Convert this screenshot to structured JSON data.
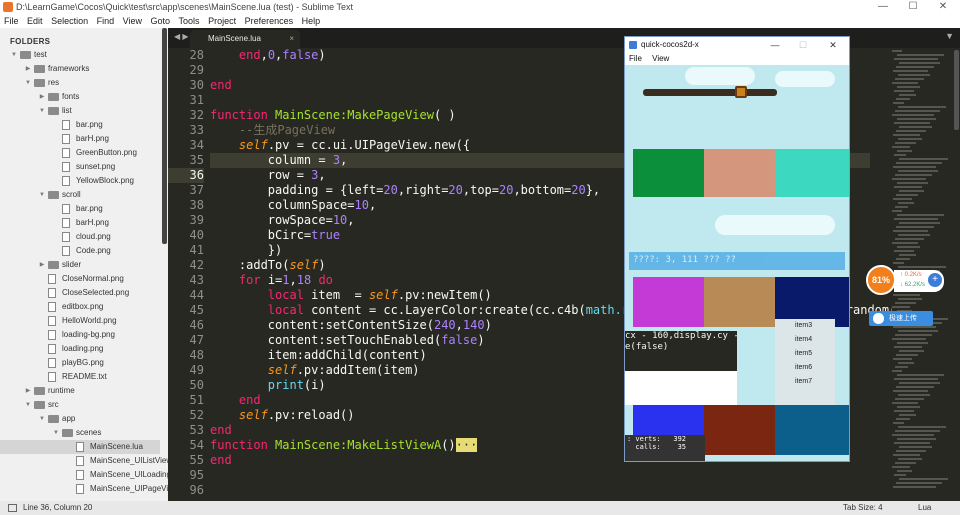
{
  "window": {
    "title": "D:\\LearnGame\\Cocos\\Quick\\test\\src\\app\\scenes\\MainScene.lua (test) - Sublime Text",
    "minimize": "—",
    "maximize": "☐",
    "close": "✕"
  },
  "menu": [
    "File",
    "Edit",
    "Selection",
    "Find",
    "View",
    "Goto",
    "Tools",
    "Project",
    "Preferences",
    "Help"
  ],
  "sidebar": {
    "header": "FOLDERS",
    "rows": [
      {
        "label": "test",
        "type": "folder",
        "depth": 0,
        "open": true
      },
      {
        "label": "frameworks",
        "type": "folder",
        "depth": 1,
        "open": false
      },
      {
        "label": "res",
        "type": "folder",
        "depth": 1,
        "open": true
      },
      {
        "label": "fonts",
        "type": "folder",
        "depth": 2,
        "open": false
      },
      {
        "label": "list",
        "type": "folder",
        "depth": 2,
        "open": true
      },
      {
        "label": "bar.png",
        "type": "file",
        "depth": 3
      },
      {
        "label": "barH.png",
        "type": "file",
        "depth": 3
      },
      {
        "label": "GreenButton.png",
        "type": "file",
        "depth": 3
      },
      {
        "label": "sunset.png",
        "type": "file",
        "depth": 3
      },
      {
        "label": "YellowBlock.png",
        "type": "file",
        "depth": 3
      },
      {
        "label": "scroll",
        "type": "folder",
        "depth": 2,
        "open": true
      },
      {
        "label": "bar.png",
        "type": "file",
        "depth": 3
      },
      {
        "label": "barH.png",
        "type": "file",
        "depth": 3
      },
      {
        "label": "cloud.png",
        "type": "file",
        "depth": 3
      },
      {
        "label": "Code.png",
        "type": "file",
        "depth": 3
      },
      {
        "label": "slider",
        "type": "folder",
        "depth": 2,
        "open": false
      },
      {
        "label": "CloseNormal.png",
        "type": "file",
        "depth": 2
      },
      {
        "label": "CloseSelected.png",
        "type": "file",
        "depth": 2
      },
      {
        "label": "editbox.png",
        "type": "file",
        "depth": 2
      },
      {
        "label": "HelloWorld.png",
        "type": "file",
        "depth": 2
      },
      {
        "label": "loading-bg.png",
        "type": "file",
        "depth": 2
      },
      {
        "label": "loading.png",
        "type": "file",
        "depth": 2
      },
      {
        "label": "playBG.png",
        "type": "file",
        "depth": 2
      },
      {
        "label": "README.txt",
        "type": "file",
        "depth": 2
      },
      {
        "label": "runtime",
        "type": "folder",
        "depth": 1,
        "open": false
      },
      {
        "label": "src",
        "type": "folder",
        "depth": 1,
        "open": true
      },
      {
        "label": "app",
        "type": "folder",
        "depth": 2,
        "open": true
      },
      {
        "label": "scenes",
        "type": "folder",
        "depth": 3,
        "open": true
      },
      {
        "label": "MainScene.lua",
        "type": "file",
        "depth": 4,
        "selected": true
      },
      {
        "label": "MainScene_UIListView.lua",
        "type": "file",
        "depth": 4
      },
      {
        "label": "MainScene_UILoadingBar.lua",
        "type": "file",
        "depth": 4
      },
      {
        "label": "MainScene_UIPageView.lua",
        "type": "file",
        "depth": 4
      }
    ]
  },
  "tab": {
    "label": "MainScene.lua",
    "close": "×"
  },
  "editor": {
    "line_numbers": [
      "28",
      "29",
      "30",
      "31",
      "32",
      "33",
      "34",
      "35",
      "36",
      "37",
      "38",
      "39",
      "40",
      "41",
      "42",
      "43",
      "44",
      "45",
      "46",
      "47",
      "48",
      "49",
      "50",
      "51",
      "52",
      "53",
      "54",
      "55",
      "95",
      "96"
    ],
    "current_line": "36"
  },
  "simulator": {
    "title": "quick-cocos2d-x",
    "menu": [
      "File",
      "View"
    ],
    "bar_text": "????: 3, 111 ??? ?? ",
    "list_items": [
      "item3",
      "item4",
      "item5",
      "item6",
      "item7"
    ],
    "overlay_code": "cx - 160,display.cy - 2\ne(false)",
    "stats": ": verts:   392\n  calls:    35",
    "colors": [
      "#0c8f3a",
      "#d4967c",
      "#3cd9c0",
      "#c43ad6",
      "#b88a55",
      "#0a1a6b",
      "#2a32f0",
      "#7a2610",
      "#0c5f8a"
    ]
  },
  "widget": {
    "percent": "81%",
    "up": "0.2K/s",
    "down": "62.2K/s",
    "upload": "极速上传"
  },
  "status": {
    "left": "Line 36, Column 20",
    "tab_size": "Tab Size: 4",
    "syntax": "Lua"
  }
}
